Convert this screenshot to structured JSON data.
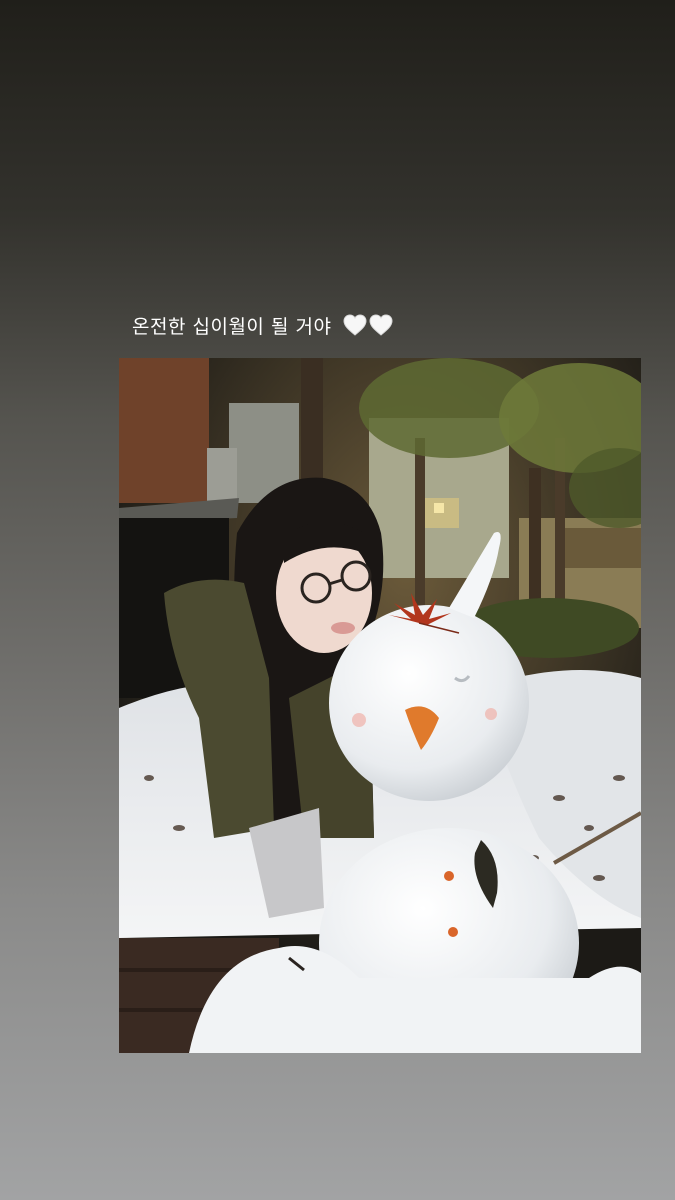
{
  "story": {
    "caption": "온전한 십이월이 될 거야",
    "caption_emoji": [
      "white-heart",
      "white-heart"
    ],
    "photo": {
      "colors": {
        "night_sky": "#2a2622",
        "snow": "#eef0f2",
        "jacket": "#4b4a30",
        "hair": "#1a1614",
        "carrot": "#e07a2c",
        "leaf": "#b2361d"
      }
    }
  }
}
